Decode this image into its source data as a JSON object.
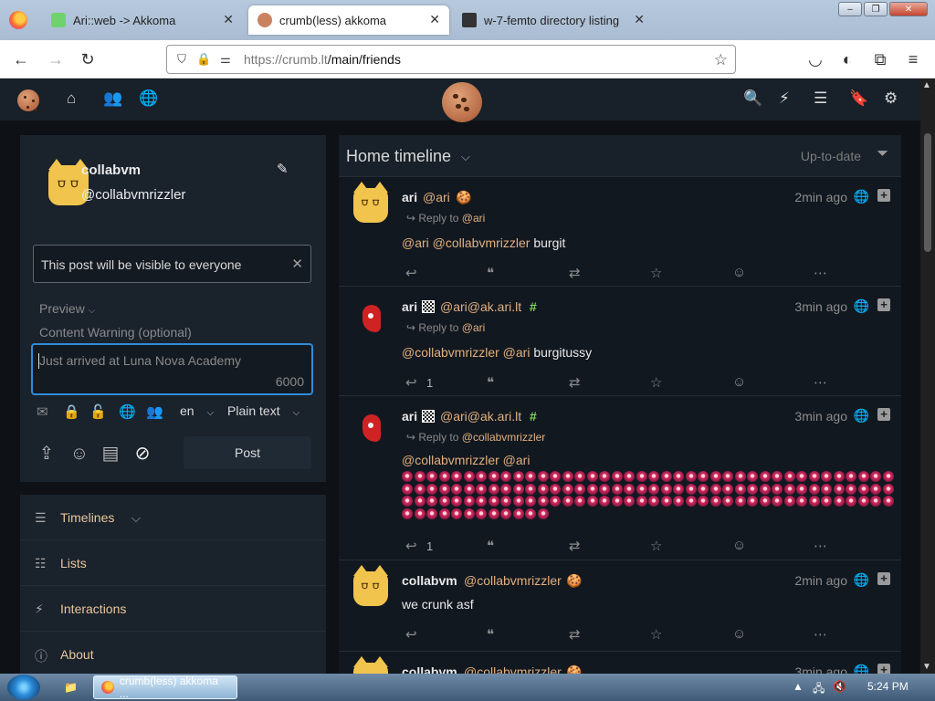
{
  "browser": {
    "tabs": [
      {
        "label": "Ari::web -> Akkoma",
        "active": false
      },
      {
        "label": "crumb(less) akkoma",
        "active": true
      },
      {
        "label": "w-7-femto directory listing",
        "active": false
      }
    ],
    "url_host": "https://crumb.lt",
    "url_path": "/main/friends",
    "tab_close": "✕",
    "winbtns": {
      "minimize": "‒",
      "restore": "❐",
      "close": "✕"
    }
  },
  "app": {
    "icons": {
      "home": "home-icon",
      "people": "people-icon",
      "globe": "globe-icon",
      "search": "search-icon",
      "bolt": "bolt-icon",
      "list": "list-icon",
      "bookmark": "bookmark-icon",
      "gear": "gear-icon"
    },
    "glyphs": {
      "home": "⌂",
      "people": "👥",
      "globe": "🌐",
      "search": "🔍",
      "bolt": "⚡",
      "list": "☰",
      "bookmark": "🔖",
      "gear": "⚙",
      "edit": "✎",
      "close": "✕",
      "chev": "⌵",
      "filter": "⏷"
    }
  },
  "profile": {
    "name": "collabvm",
    "handle": "@collabvmrizzler"
  },
  "composer": {
    "visibility_text": "This post will be visible to everyone",
    "preview_label": "Preview",
    "cw_placeholder": "Content Warning (optional)",
    "placeholder": "Just arrived at Luna Nova Academy",
    "char_count": "6000",
    "language": "en",
    "format": "Plain text",
    "post_label": "Post"
  },
  "menu": {
    "items": [
      {
        "label": "Timelines",
        "icon": "bars-icon"
      },
      {
        "label": "Lists",
        "icon": "list-icon"
      },
      {
        "label": "Interactions",
        "icon": "bolt-icon"
      },
      {
        "label": "About",
        "icon": "info-icon"
      }
    ]
  },
  "timeline": {
    "title": "Home timeline",
    "status": "Up-to-date",
    "reply_to_label": "Reply to",
    "posts": [
      {
        "name": "ari",
        "handle": "@ari",
        "time": "2min ago",
        "reply_to": "@ari",
        "body_mentions": "@ari @collabvmrizzler",
        "body_text": " burgit",
        "reply_count": ""
      },
      {
        "name": "ari",
        "handle": "@ari@ak.ari.lt",
        "time": "3min ago",
        "reply_to": "@ari",
        "body_mentions": "@collabvmrizzler @ari",
        "body_text": " burgitussy",
        "reply_count": "1"
      },
      {
        "name": "ari",
        "handle": "@ari@ak.ari.lt",
        "time": "3min ago",
        "reply_to": "@collabvmrizzler",
        "body_mentions": "@collabvmrizzler @ari",
        "body_text": "",
        "reply_count": "1"
      },
      {
        "name": "collabvm",
        "handle": "@collabvmrizzler",
        "time": "2min ago",
        "reply_to": "",
        "body_mentions": "",
        "body_text": "we crunk asf",
        "reply_count": ""
      },
      {
        "name": "collabvm",
        "handle": "@collabvmrizzler",
        "time": "3min ago",
        "reply_to": "",
        "body_mentions": "",
        "body_text": "",
        "reply_count": ""
      }
    ]
  },
  "taskbar": {
    "active_item": "crumb(less) akkoma ...",
    "time": "5:24 PM"
  }
}
